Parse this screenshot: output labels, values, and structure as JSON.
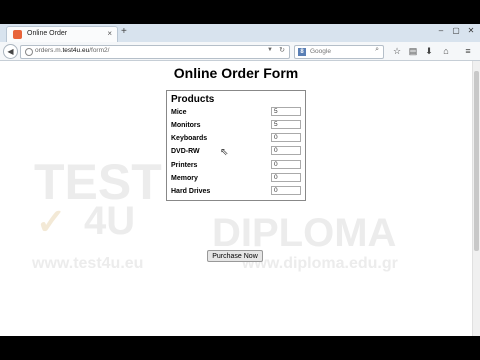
{
  "browser": {
    "tab_title": "Online Order",
    "tab_close": "×",
    "new_tab": "+",
    "url_prefix": "orders.m.",
    "url_host": "test4u.eu",
    "url_path": "/form2/",
    "search_placeholder": "Google",
    "window_controls": [
      "–",
      "▢",
      "✕"
    ]
  },
  "watermark": {
    "brand_top": "TEST",
    "brand_bottom": "4U",
    "brand_right": "DIPLOMA",
    "url_left": "www.test4u.eu",
    "url_right": "www.diploma.edu.gr"
  },
  "form": {
    "title": "Online Order Form",
    "legend": "Products",
    "rows": [
      {
        "label": "Mice",
        "value": "5"
      },
      {
        "label": "Monitors",
        "value": "5"
      },
      {
        "label": "Keyboards",
        "value": "0"
      },
      {
        "label": "DVD-RW",
        "value": "0"
      },
      {
        "label": "Printers",
        "value": "0"
      },
      {
        "label": "Memory",
        "value": "0"
      },
      {
        "label": "Hard Drives",
        "value": "0"
      }
    ],
    "submit_label": "Purchase Now"
  }
}
